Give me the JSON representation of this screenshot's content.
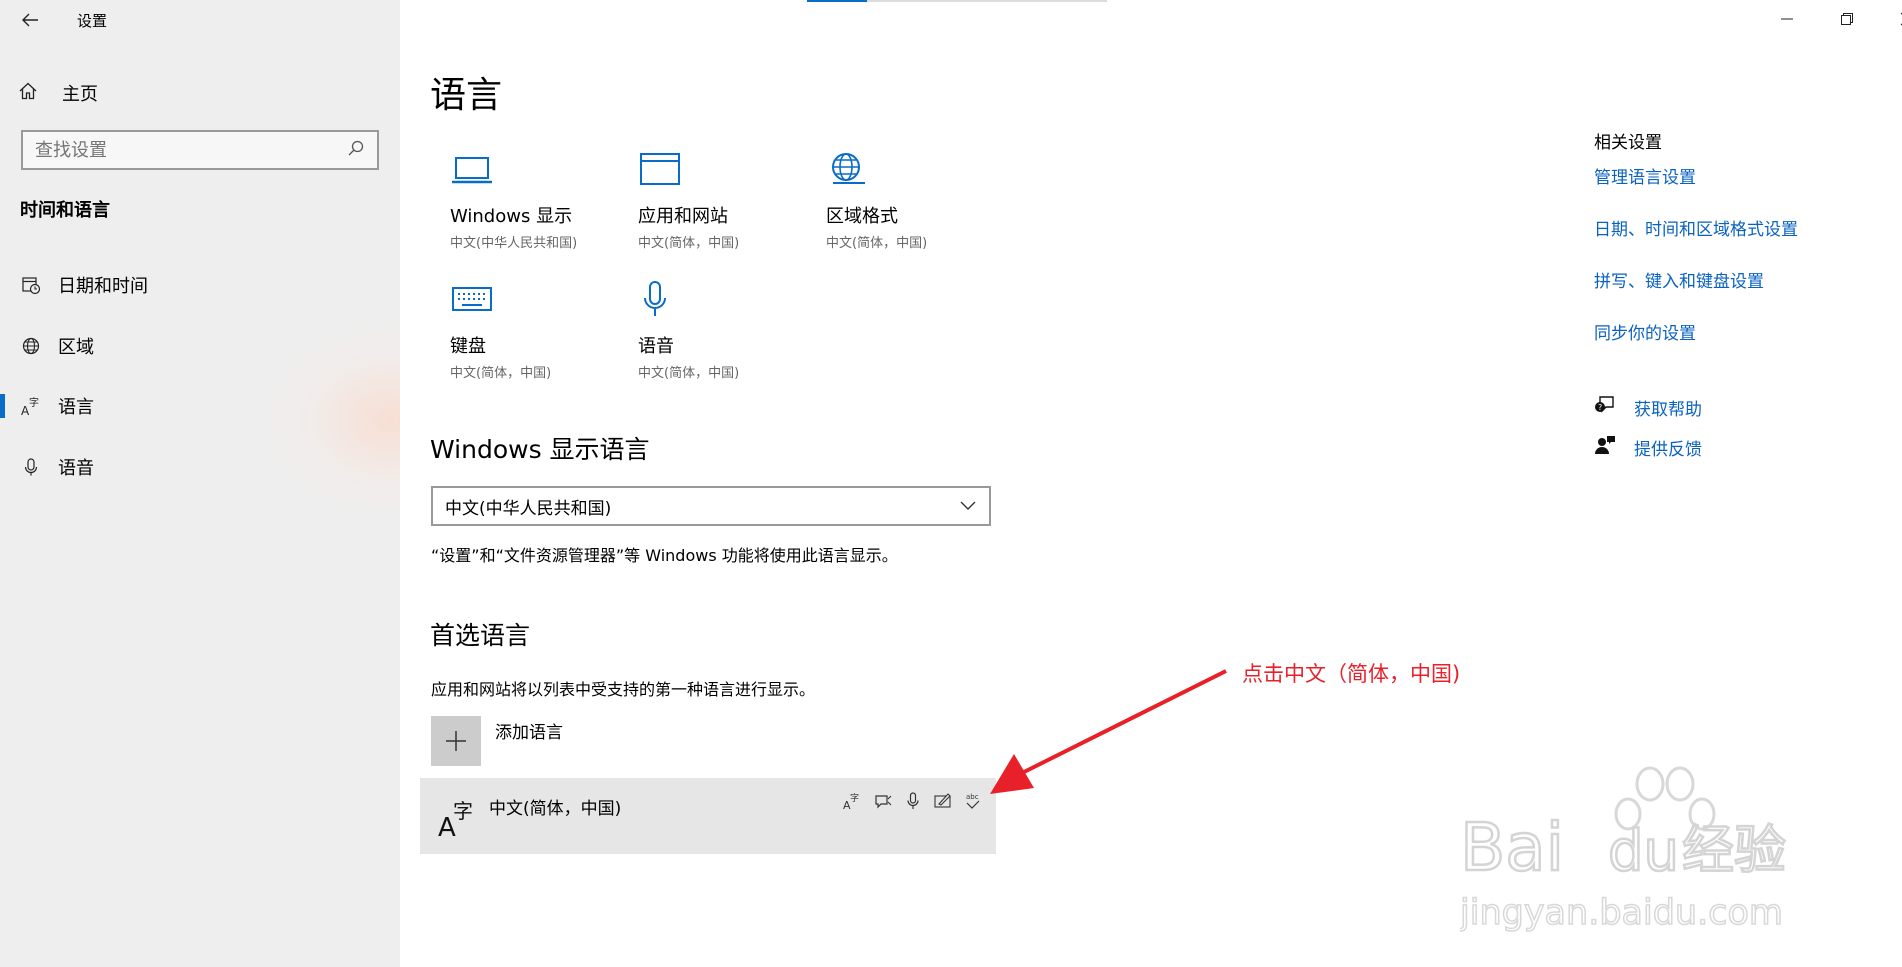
{
  "window": {
    "title": "设置",
    "controls": [
      "minimize",
      "maximize",
      "close"
    ]
  },
  "sidebar": {
    "home_label": "主页",
    "search_placeholder": "查找设置",
    "section_title": "时间和语言",
    "items": [
      {
        "label": "日期和时间",
        "icon": "calendar-clock-icon",
        "selected": false
      },
      {
        "label": "区域",
        "icon": "globe-icon",
        "selected": false
      },
      {
        "label": "语言",
        "icon": "language-icon",
        "selected": true
      },
      {
        "label": "语音",
        "icon": "microphone-icon",
        "selected": false
      }
    ]
  },
  "main": {
    "title": "语言",
    "tiles": [
      {
        "name": "Windows 显示",
        "sub": "中文(中华人民共和国)",
        "icon": "laptop-icon"
      },
      {
        "name": "应用和网站",
        "sub": "中文(简体，中国)",
        "icon": "window-icon"
      },
      {
        "name": "区域格式",
        "sub": "中文(简体，中国)",
        "icon": "regional-format-icon"
      },
      {
        "name": "键盘",
        "sub": "中文(简体，中国)",
        "icon": "keyboard-icon"
      },
      {
        "name": "语音",
        "sub": "中文(简体，中国)",
        "icon": "microphone-icon"
      }
    ],
    "display_language": {
      "heading": "Windows 显示语言",
      "selected": "中文(中华人民共和国)",
      "description": "“设置”和“文件资源管理器”等 Windows 功能将使用此语言显示。"
    },
    "preferred": {
      "heading": "首选语言",
      "description": "应用和网站将以列表中受支持的第一种语言进行显示。",
      "add_label": "添加语言",
      "languages": [
        {
          "name": "中文(简体，中国)",
          "features": [
            "display-language-icon",
            "speech-recognition-icon",
            "microphone-icon",
            "handwriting-icon",
            "spell-check-icon"
          ]
        }
      ]
    }
  },
  "related": {
    "heading": "相关设置",
    "links": [
      "管理语言设置",
      "日期、时间和区域格式设置",
      "拼写、键入和键盘设置",
      "同步你的设置"
    ],
    "help": "获取帮助",
    "feedback": "提供反馈"
  },
  "annotation": {
    "text": "点击中文（简体，中国)",
    "color": "#e8202a"
  },
  "watermark": {
    "brand": "Bai",
    "brand2": "du",
    "brand3": "经验",
    "url": "jingyan.baidu.com"
  },
  "colors": {
    "accent": "#0a6cc9",
    "link": "#0a62c0",
    "sidebar_bg": "#eeeeee",
    "selected_row_bg": "#e6e6e6"
  }
}
